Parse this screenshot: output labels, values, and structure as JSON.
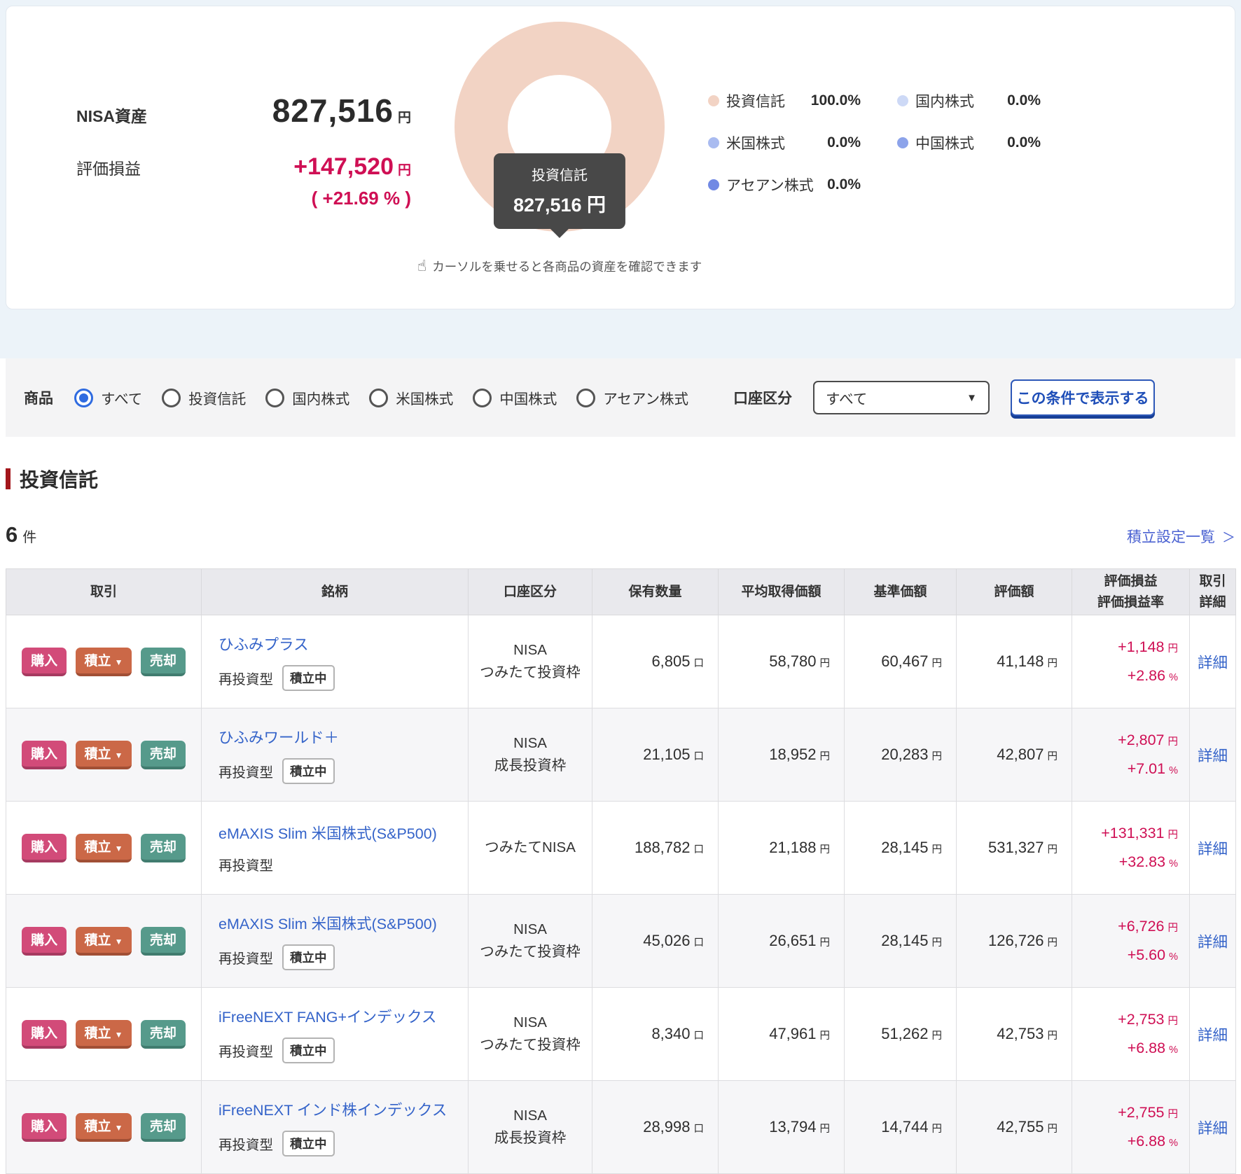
{
  "summary": {
    "asset_label": "NISA資産",
    "asset_value": "827,516",
    "asset_unit": "円",
    "pl_label": "評価損益",
    "pl_value": "+147,520",
    "pl_unit": "円",
    "pl_pct": "( +21.69 % )",
    "tooltip": {
      "label": "投資信託",
      "value": "827,516 円"
    },
    "hint_icon": "☝",
    "hint": "カーソルを乗せると各商品の資産を確認できます",
    "legend": [
      {
        "label": "投資信託",
        "pct": "100.0%",
        "color": "#f2d3c4"
      },
      {
        "label": "国内株式",
        "pct": "0.0%",
        "color": "#cdd9f6"
      },
      {
        "label": "米国株式",
        "pct": "0.0%",
        "color": "#a9bbf0"
      },
      {
        "label": "中国株式",
        "pct": "0.0%",
        "color": "#8ca3ea"
      },
      {
        "label": "アセアン株式",
        "pct": "0.0%",
        "color": "#7189e4"
      }
    ],
    "chart": {
      "type": "donut",
      "slices": [
        {
          "label": "投資信託",
          "value_yen": 827516,
          "pct": 100.0
        }
      ]
    }
  },
  "filter": {
    "product_label": "商品",
    "options": [
      {
        "label": "すべて",
        "selected": true
      },
      {
        "label": "投資信託",
        "selected": false
      },
      {
        "label": "国内株式",
        "selected": false
      },
      {
        "label": "米国株式",
        "selected": false
      },
      {
        "label": "中国株式",
        "selected": false
      },
      {
        "label": "アセアン株式",
        "selected": false
      }
    ],
    "account_label": "口座区分",
    "account_value": "すべて",
    "account_caret": "▼",
    "submit_label": "この条件で表示する"
  },
  "section": {
    "title": "投資信託",
    "count": "6",
    "count_unit": "件",
    "tsumitate_link": "積立設定一覧",
    "tsumitate_chevron": "＞"
  },
  "table": {
    "headers": {
      "trade": "取引",
      "fund": "銘柄",
      "account": "口座区分",
      "quantity": "保有数量",
      "avg_price": "平均取得価額",
      "nav": "基準価額",
      "value": "評価額",
      "pl_line1": "評価損益",
      "pl_line2": "評価損益率",
      "detail_line1": "取引",
      "detail_line2": "詳細"
    },
    "actions": {
      "buy": "購入",
      "tsumitate": "積立",
      "tsumitate_caret": "▼",
      "sell": "売却",
      "detail": "詳細"
    },
    "units": {
      "qty": "口",
      "yen": "円",
      "pct": "%"
    },
    "rows": [
      {
        "name": "ひふみプラス",
        "type": "再投資型",
        "badge": "積立中",
        "account": [
          "NISA",
          "つみたて投資枠"
        ],
        "qty": "6,805",
        "avg": "58,780",
        "nav": "60,467",
        "value": "41,148",
        "pl": "+1,148",
        "pl_pct": "+2.86"
      },
      {
        "name": "ひふみワールド＋",
        "type": "再投資型",
        "badge": "積立中",
        "account": [
          "NISA",
          "成長投資枠"
        ],
        "qty": "21,105",
        "avg": "18,952",
        "nav": "20,283",
        "value": "42,807",
        "pl": "+2,807",
        "pl_pct": "+7.01"
      },
      {
        "name": "eMAXIS Slim 米国株式(S&P500)",
        "type": "再投資型",
        "badge": "",
        "account": [
          "つみたてNISA"
        ],
        "qty": "188,782",
        "avg": "21,188",
        "nav": "28,145",
        "value": "531,327",
        "pl": "+131,331",
        "pl_pct": "+32.83"
      },
      {
        "name": "eMAXIS Slim 米国株式(S&P500)",
        "type": "再投資型",
        "badge": "積立中",
        "account": [
          "NISA",
          "つみたて投資枠"
        ],
        "qty": "45,026",
        "avg": "26,651",
        "nav": "28,145",
        "value": "126,726",
        "pl": "+6,726",
        "pl_pct": "+5.60"
      },
      {
        "name": "iFreeNEXT FANG+インデックス",
        "type": "再投資型",
        "badge": "積立中",
        "account": [
          "NISA",
          "つみたて投資枠"
        ],
        "qty": "8,340",
        "avg": "47,961",
        "nav": "51,262",
        "value": "42,753",
        "pl": "+2,753",
        "pl_pct": "+6.88"
      },
      {
        "name": "iFreeNEXT インド株インデックス",
        "type": "再投資型",
        "badge": "積立中",
        "account": [
          "NISA",
          "成長投資枠"
        ],
        "qty": "28,998",
        "avg": "13,794",
        "nav": "14,744",
        "value": "42,755",
        "pl": "+2,755",
        "pl_pct": "+6.88"
      }
    ]
  }
}
